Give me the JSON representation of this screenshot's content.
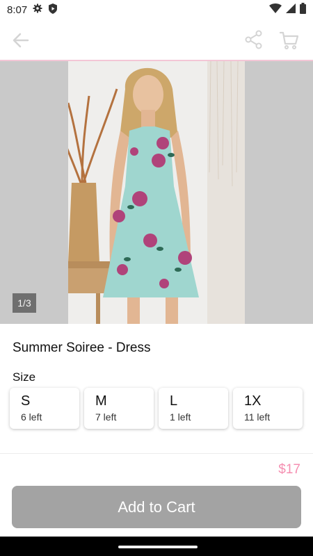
{
  "status_bar": {
    "time": "8:07",
    "icons": [
      "settings-gear-icon",
      "shield-icon",
      "wifi-icon",
      "signal-icon",
      "battery-icon"
    ]
  },
  "app_bar": {
    "icons": [
      "back-arrow-icon",
      "share-icon",
      "cart-icon"
    ]
  },
  "gallery": {
    "counter": "1/3",
    "image": "woman-in-floral-dress-photo"
  },
  "product": {
    "title": "Summer Soiree - Dress",
    "size_label": "Size",
    "sizes": [
      {
        "size": "S",
        "left": "6 left"
      },
      {
        "size": "M",
        "left": "7 left"
      },
      {
        "size": "L",
        "left": "1 left"
      },
      {
        "size": "1X",
        "left": "11 left"
      }
    ],
    "price": "$17",
    "cta": "Add to Cart"
  },
  "colors": {
    "accent_pink": "#f58fb1",
    "button_gray": "#a3a3a3"
  }
}
